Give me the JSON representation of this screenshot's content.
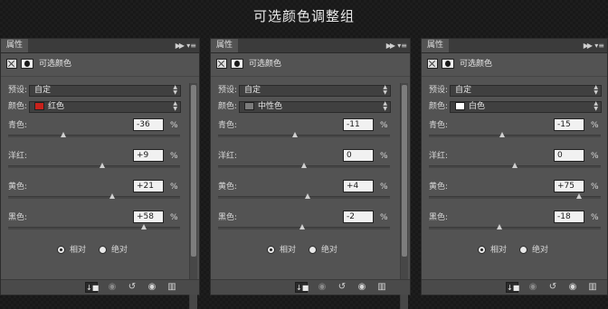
{
  "page_title": "可选颜色调整组",
  "panels": [
    {
      "tab": "属性",
      "type_title": "可选颜色",
      "preset_label": "预设:",
      "preset_value": "自定",
      "colors_label": "颜色:",
      "colors_value": "红色",
      "swatch_color": "#c8221c",
      "sliders": [
        {
          "label": "青色:",
          "value": "-36",
          "level": -36
        },
        {
          "label": "洋红:",
          "value": "+9",
          "level": 9
        },
        {
          "label": "黄色:",
          "value": "+21",
          "level": 21
        },
        {
          "label": "黑色:",
          "value": "+58",
          "level": 58
        }
      ],
      "relative": "相对",
      "absolute": "绝对",
      "pct": "%"
    },
    {
      "tab": "属性",
      "type_title": "可选颜色",
      "preset_label": "预设:",
      "preset_value": "自定",
      "colors_label": "颜色:",
      "colors_value": "中性色",
      "swatch_color": "#7b7b7b",
      "sliders": [
        {
          "label": "青色:",
          "value": "-11",
          "level": -11
        },
        {
          "label": "洋红:",
          "value": "0",
          "level": 0
        },
        {
          "label": "黄色:",
          "value": "+4",
          "level": 4
        },
        {
          "label": "黑色:",
          "value": "-2",
          "level": -2
        }
      ],
      "relative": "相对",
      "absolute": "绝对",
      "pct": "%"
    },
    {
      "tab": "属性",
      "type_title": "可选颜色",
      "preset_label": "预设:",
      "preset_value": "自定",
      "colors_label": "颜色:",
      "colors_value": "白色",
      "swatch_color": "#ffffff",
      "sliders": [
        {
          "label": "青色:",
          "value": "-15",
          "level": -15
        },
        {
          "label": "洋红:",
          "value": "0",
          "level": 0
        },
        {
          "label": "黄色:",
          "value": "+75",
          "level": 75
        },
        {
          "label": "黑色:",
          "value": "-18",
          "level": -18
        }
      ],
      "relative": "相对",
      "absolute": "绝对",
      "pct": "%"
    }
  ],
  "icons": {
    "collapse": "double-right-arrow-icon",
    "menu": "panel-menu-icon",
    "adjustment": "selective-color-adjustment-icon",
    "mask": "layer-mask-icon",
    "clip": "clip-to-layer-icon",
    "view_previous": "view-previous-state-icon",
    "reset": "reset-icon",
    "visibility": "eye-icon",
    "trash": "trash-icon"
  }
}
